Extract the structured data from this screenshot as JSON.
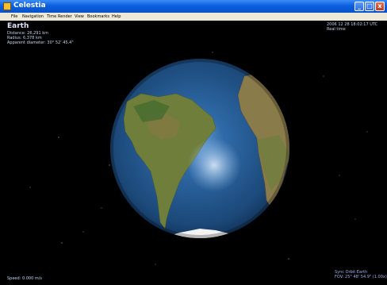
{
  "window": {
    "title": "Celestia",
    "minimize_glyph": "_",
    "maximize_glyph": "□",
    "close_glyph": "x"
  },
  "menu": {
    "items": [
      "File",
      "Navigation",
      "Time",
      "Render",
      "View",
      "Bookmarks",
      "Help"
    ]
  },
  "hud": {
    "object_name": "Earth",
    "distance": "Distance: 26,291 km",
    "radius": "Radius: 6,378 km",
    "apparent_diameter": "Apparent diameter: 30° 52' 45.4\"",
    "datetime": "2006 12 28 18:02:17 UTC",
    "time_mode": "Real time",
    "speed": "Speed: 0.000 m/s",
    "sync_orbit": "Sync Orbit Earth",
    "fov": "FOV: 25° 48' 54.9\" (1.00x)"
  },
  "colors": {
    "titlebar": "#0b5fe0",
    "menubar": "#ece9d8",
    "space": "#000000",
    "ocean": "#1d4f8a",
    "land": "#6f7e3a",
    "ice": "#f2f2f2",
    "hud_text": "#bfd4ee"
  }
}
